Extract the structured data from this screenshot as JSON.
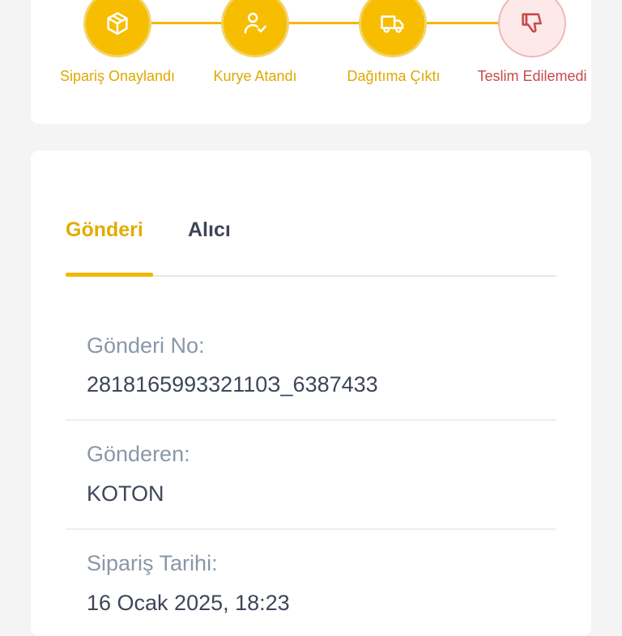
{
  "tracking": {
    "steps": [
      {
        "label": "Sipariş Onaylandı",
        "icon": "package-icon",
        "status": "done"
      },
      {
        "label": "Kurye Atandı",
        "icon": "courier-check-icon",
        "status": "done"
      },
      {
        "label": "Dağıtıma Çıktı",
        "icon": "truck-icon",
        "status": "done"
      },
      {
        "label": "Teslim Edilemedi",
        "icon": "thumbs-down-icon",
        "status": "failed"
      }
    ],
    "colors": {
      "accent": "#f7bd00",
      "fail": "#c84a4a",
      "fail_bg": "#fde9e9"
    }
  },
  "details": {
    "tabs": [
      {
        "label": "Gönderi",
        "active": true
      },
      {
        "label": "Alıcı",
        "active": false
      }
    ],
    "fields": [
      {
        "label": "Gönderi No:",
        "value": "281816599332110З_6387433"
      },
      {
        "label": "Gönderen:",
        "value": "KOTON"
      },
      {
        "label": "Sipariş Tarihi:",
        "value": "16 Ocak 2025, 18:23"
      }
    ]
  }
}
